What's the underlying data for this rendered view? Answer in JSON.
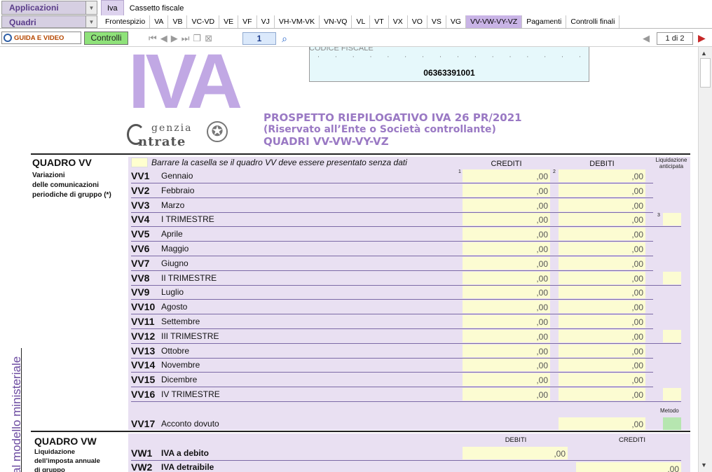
{
  "menu": {
    "applicazioni": "Applicazioni",
    "quadri": "Quadri",
    "top_tabs": [
      "Iva",
      "Cassetto fiscale"
    ],
    "quadri_tabs": [
      "Frontespizio",
      "VA",
      "VB",
      "VC-VD",
      "VE",
      "VF",
      "VJ",
      "VH-VM-VK",
      "VN-VQ",
      "VL",
      "VT",
      "VX",
      "VO",
      "VS",
      "VG",
      "VV-VW-VY-VZ",
      "Pagamenti",
      "Controlli finali"
    ]
  },
  "toolbar": {
    "guida": "GUIDA E VIDEO",
    "controlli": "Controlli",
    "page_input": "1",
    "pager": "1 di 2"
  },
  "doc": {
    "codice_fiscale_label": "CODICE FISCALE",
    "codice_fiscale": "06363391001",
    "agenzia_line1": "genzia",
    "agenzia_line2": "ntrate",
    "title1": "PROSPETTO RIEPILOGATIVO IVA 26 PR/2021",
    "title2": "(Riservato all’Ente o Società controllante)",
    "title3": "QUADRI VV-VW-VY-VZ",
    "vertical_text": "al modello ministeriale",
    "vv": {
      "title": "QUADRO VV",
      "sub1": "Variazioni",
      "sub2": "delle comunicazioni",
      "sub3": "periodiche di gruppo (*)",
      "barrare": "Barrare la casella se il quadro VV deve essere presentato senza dati",
      "crediti": "CREDITI",
      "debiti": "DEBITI",
      "liq_head": "Liquidazione anticipata",
      "metodo": "Metodo",
      "sup1": "1",
      "sup2": "2",
      "sup3": "3",
      "zero": ",00",
      "rows": [
        {
          "code": "VV1",
          "desc": "Gennaio"
        },
        {
          "code": "VV2",
          "desc": "Febbraio"
        },
        {
          "code": "VV3",
          "desc": "Marzo"
        },
        {
          "code": "VV4",
          "desc": "I TRIMESTRE"
        },
        {
          "code": "VV5",
          "desc": "Aprile"
        },
        {
          "code": "VV6",
          "desc": "Maggio"
        },
        {
          "code": "VV7",
          "desc": "Giugno"
        },
        {
          "code": "VV8",
          "desc": "II TRIMESTRE"
        },
        {
          "code": "VV9",
          "desc": "Luglio"
        },
        {
          "code": "VV10",
          "desc": "Agosto"
        },
        {
          "code": "VV11",
          "desc": "Settembre"
        },
        {
          "code": "VV12",
          "desc": "III TRIMESTRE"
        },
        {
          "code": "VV13",
          "desc": "Ottobre"
        },
        {
          "code": "VV14",
          "desc": "Novembre"
        },
        {
          "code": "VV15",
          "desc": "Dicembre"
        },
        {
          "code": "VV16",
          "desc": "IV TRIMESTRE"
        }
      ],
      "vv17_code": "VV17",
      "vv17_desc": "Acconto dovuto"
    },
    "vw": {
      "title": "QUADRO VW",
      "sub1": "Liquidazione",
      "sub2": "dell’imposta annuale",
      "sub3": "di gruppo",
      "debiti": "DEBITI",
      "crediti": "CREDITI",
      "rows": [
        {
          "code": "VW1",
          "desc": "IVA a debito"
        },
        {
          "code": "VW2",
          "desc": "IVA detraibile"
        }
      ],
      "zero": ",00"
    }
  }
}
